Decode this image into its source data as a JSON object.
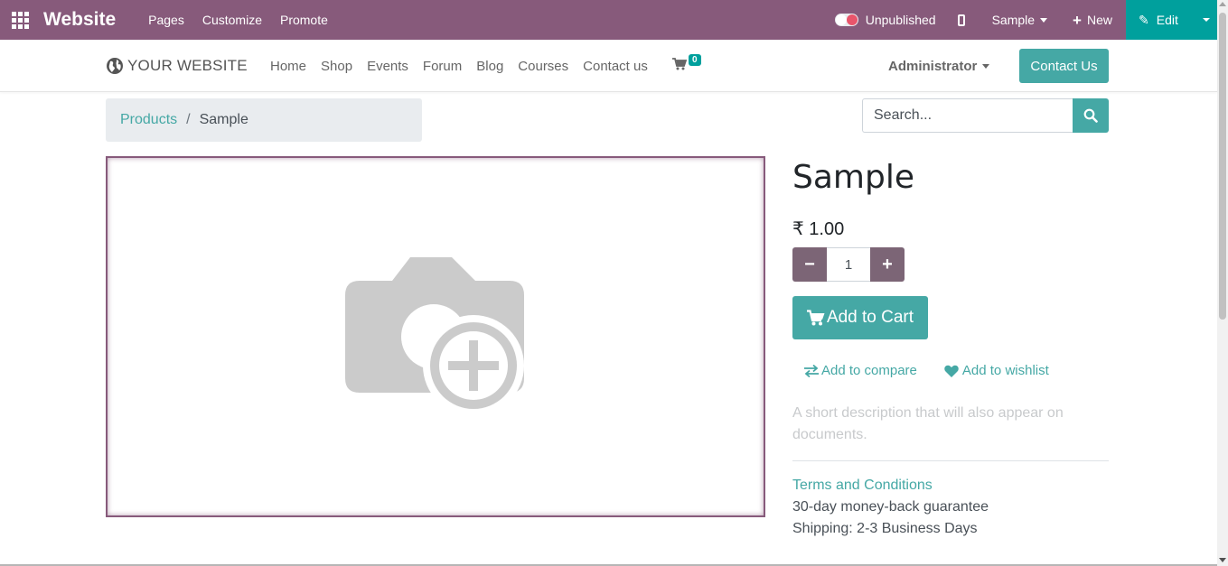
{
  "admin_bar": {
    "brand": "Website",
    "menus": [
      "Pages",
      "Customize",
      "Promote"
    ],
    "publish_status": "Unpublished",
    "language": "Sample",
    "new_label": "New",
    "edit_label": "Edit",
    "color": "#875a7b",
    "edit_color": "#00a09d"
  },
  "site_header": {
    "logo_text": "YOUR WEBSITE",
    "nav": [
      "Home",
      "Shop",
      "Events",
      "Forum",
      "Blog",
      "Courses",
      "Contact us"
    ],
    "cart_count": "0",
    "user": "Administrator",
    "contact_button": "Contact Us",
    "accent": "#45a8a5"
  },
  "breadcrumb": {
    "parent": "Products",
    "separator": "/",
    "current": "Sample"
  },
  "search": {
    "placeholder": "Search..."
  },
  "product": {
    "name": "Sample",
    "price": "₹ 1.00",
    "quantity": "1",
    "add_to_cart": "Add to Cart",
    "add_to_compare": "Add to compare",
    "add_to_wishlist": "Add to wishlist",
    "short_description": "A short description that will also appear on documents.",
    "terms": "Terms and Conditions",
    "guarantee": "30-day money-back guarantee",
    "shipping": "Shipping: 2-3 Business Days",
    "image_placeholder_icon": "camera-plus-icon"
  }
}
